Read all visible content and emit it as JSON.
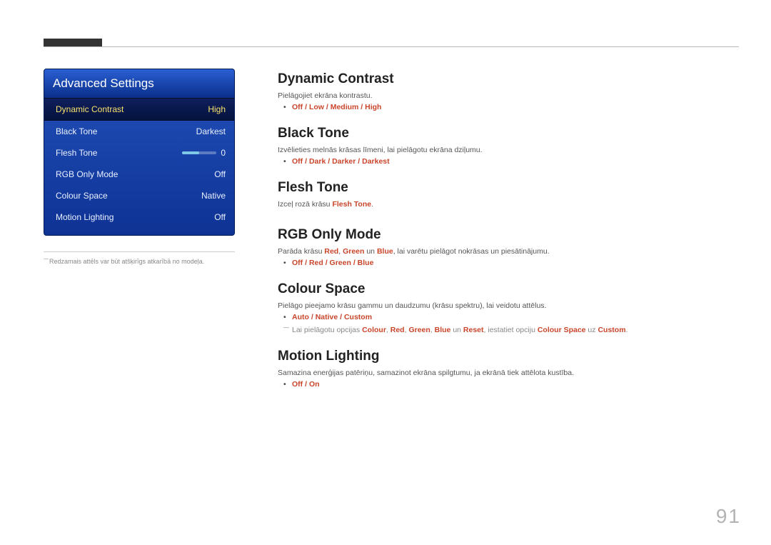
{
  "page_number": "91",
  "osd": {
    "title": "Advanced Settings",
    "items": [
      {
        "label": "Dynamic Contrast",
        "value": "High",
        "selected": true
      },
      {
        "label": "Black Tone",
        "value": "Darkest"
      },
      {
        "label": "Flesh Tone",
        "value": "0",
        "slider": true
      },
      {
        "label": "RGB Only Mode",
        "value": "Off"
      },
      {
        "label": "Colour Space",
        "value": "Native"
      },
      {
        "label": "Motion Lighting",
        "value": "Off"
      }
    ]
  },
  "left_footnote": "Redzamais attēls var būt atšķirīgs atkarībā no modeļa.",
  "sections": {
    "dynamic_contrast": {
      "title": "Dynamic Contrast",
      "desc": "Pielāgojiet ekrāna kontrastu.",
      "options": [
        "Off",
        "Low",
        "Medium",
        "High"
      ]
    },
    "black_tone": {
      "title": "Black Tone",
      "desc": "Izvēlieties melnās krāsas līmeni, lai pielāgotu ekrāna dziļumu.",
      "options": [
        "Off",
        "Dark",
        "Darker",
        "Darkest"
      ]
    },
    "flesh_tone": {
      "title": "Flesh Tone",
      "desc_pre": "Izceļ rozā krāsu ",
      "desc_em": "Flesh Tone",
      "desc_post": "."
    },
    "rgb_only": {
      "title": "RGB Only Mode",
      "desc_pre": "Parāda krāsu ",
      "red": "Red",
      "green": "Green",
      "blue": "Blue",
      "desc_mid1": ", ",
      "desc_mid2": " un ",
      "desc_post": ", lai varētu pielāgot nokrāsas un piesātinājumu.",
      "options": [
        "Off",
        "Red",
        "Green",
        "Blue"
      ]
    },
    "colour_space": {
      "title": "Colour Space",
      "desc": "Pielāgo pieejamo krāsu gammu un daudzumu (krāsu spektru), lai veidotu attēlus.",
      "options": [
        "Auto",
        "Native",
        "Custom"
      ],
      "note_pre": "Lai pielāgotu opcijas ",
      "note_colour": "Colour",
      "note_red": "Red",
      "note_green": "Green",
      "note_blue": "Blue",
      "note_mid1": ", ",
      "note_and": " un ",
      "note_reset": "Reset",
      "note_mid2": ", iestatiet opciju ",
      "note_cs": "Colour Space",
      "note_to": " uz ",
      "note_custom": "Custom",
      "note_end": "."
    },
    "motion_lighting": {
      "title": "Motion Lighting",
      "desc": "Samazina enerģijas patēriņu, samazinot ekrāna spilgtumu, ja ekrānā tiek attēlota kustība.",
      "options": [
        "Off",
        "On"
      ]
    }
  }
}
